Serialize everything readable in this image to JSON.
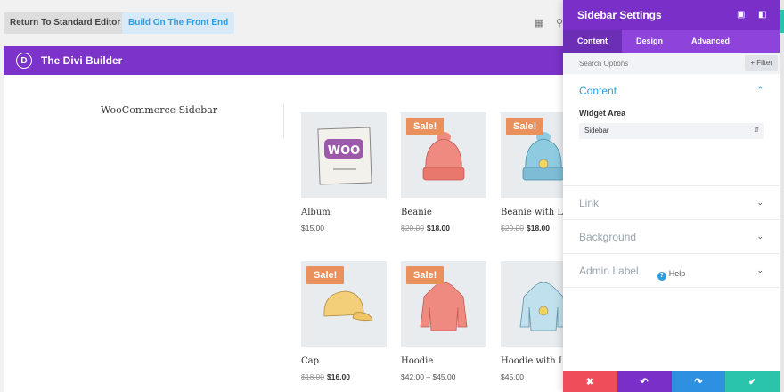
{
  "topbar": {
    "return_label": "Return To Standard Editor",
    "front_label": "Build On The Front End",
    "layout_icon": "layout-icon",
    "search_icon": "search-icon"
  },
  "builder": {
    "logo_letter": "D",
    "title": "The Divi Builder"
  },
  "canvas": {
    "sidebar_title": "WooCommerce Sidebar",
    "sale_label": "Sale!",
    "products": [
      {
        "name": "Album",
        "price": "$15.00",
        "old_price": "",
        "new_price": "",
        "sale": false
      },
      {
        "name": "Beanie",
        "price": "",
        "old_price": "$20.00",
        "new_price": "$18.00",
        "sale": true
      },
      {
        "name": "Beanie with Logo",
        "price": "",
        "old_price": "$20.00",
        "new_price": "$18.00",
        "sale": true
      },
      {
        "name": "Cap",
        "price": "",
        "old_price": "$18.00",
        "new_price": "$16.00",
        "sale": true
      },
      {
        "name": "Hoodie",
        "price": "$42.00 – $45.00",
        "old_price": "",
        "new_price": "",
        "sale": true
      },
      {
        "name": "Hoodie with Logo",
        "price": "$45.00",
        "old_price": "",
        "new_price": "",
        "sale": false
      }
    ]
  },
  "panel": {
    "title": "Sidebar Settings",
    "tabs": [
      "Content",
      "Design",
      "Advanced"
    ],
    "search_placeholder": "Search Options",
    "filter_label": "+ Filter",
    "sections": {
      "content": "Content",
      "link": "Link",
      "background": "Background",
      "admin_label": "Admin Label"
    },
    "widget_area_label": "Widget Area",
    "widget_area_value": "Sidebar",
    "help_label": "Help"
  },
  "colors": {
    "purple": "#7b33c9",
    "blue": "#2e9de0",
    "red": "#ef4d5a",
    "teal": "#29c4a9",
    "sale": "#e9905c"
  }
}
